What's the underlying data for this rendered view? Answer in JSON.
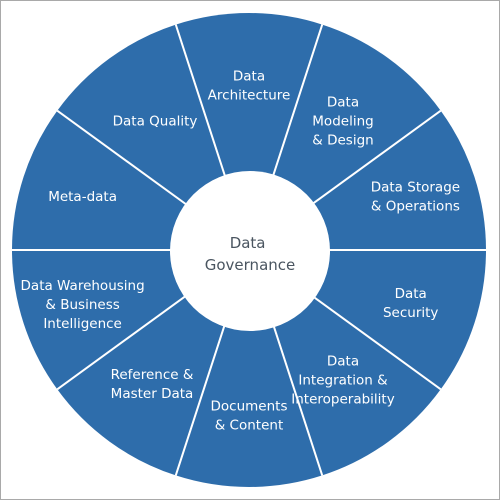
{
  "diagram": {
    "type": "wheel",
    "fill_color": "#2e6dab",
    "separator_color": "#ffffff",
    "center": {
      "label_lines": [
        "Data",
        "Governance"
      ],
      "text_color": "#4a5560"
    },
    "segments": [
      {
        "name": "data-architecture",
        "label_lines": [
          "Data",
          "Architecture"
        ]
      },
      {
        "name": "data-modeling-design",
        "label_lines": [
          "Data",
          "Modeling",
          "& Design"
        ]
      },
      {
        "name": "data-storage-operations",
        "label_lines": [
          "Data Storage",
          "& Operations"
        ]
      },
      {
        "name": "data-security",
        "label_lines": [
          "Data",
          "Security"
        ]
      },
      {
        "name": "data-integration-interoperability",
        "label_lines": [
          "Data",
          "Integration &",
          "Interoperability"
        ]
      },
      {
        "name": "documents-content",
        "label_lines": [
          "Documents",
          "& Content"
        ]
      },
      {
        "name": "reference-master-data",
        "label_lines": [
          "Reference &",
          "Master Data"
        ]
      },
      {
        "name": "data-warehousing-bi",
        "label_lines": [
          "Data Warehousing",
          "& Business",
          "Intelligence"
        ]
      },
      {
        "name": "meta-data",
        "label_lines": [
          "Meta-data"
        ]
      },
      {
        "name": "data-quality",
        "label_lines": [
          "Data Quality"
        ]
      }
    ]
  }
}
